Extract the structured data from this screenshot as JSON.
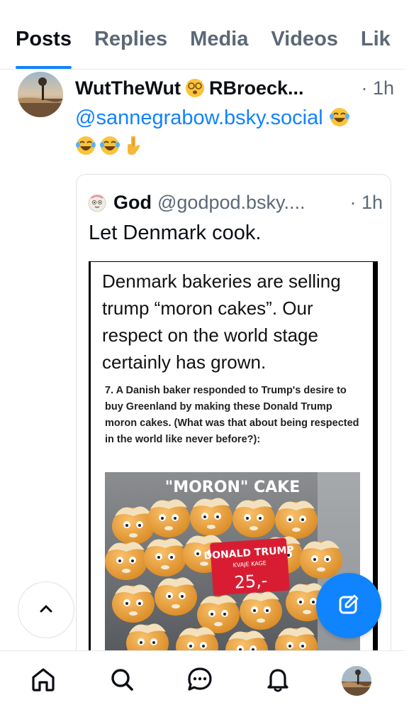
{
  "tabs": [
    {
      "label": "Posts"
    },
    {
      "label": "Replies"
    },
    {
      "label": "Media"
    },
    {
      "label": "Videos"
    },
    {
      "label": "Lik"
    }
  ],
  "post": {
    "author_name_part1": "WutTheWut",
    "author_name_part2": "RBroeck...",
    "time": "· 1h",
    "mention": "@sannegrabow.bsky.social",
    "emojis_line1": [
      "laughing-tears-emoji"
    ],
    "emojis_line2": [
      "laughing-tears-emoji",
      "laughing-tears-emoji",
      "pointing-down-emoji"
    ]
  },
  "quote": {
    "name": "God",
    "handle": "@godpod.bsky....",
    "time": "· 1h",
    "text": "Let Denmark cook.",
    "image": {
      "caption": "Denmark bakeries are selling trump “moron cakes”. Our respect on the world stage certainly has grown.",
      "subtext": "7. A Danish baker responded to Trump's desire to buy Greenland by making these Donald Trump moron cakes. (What was that about being respected in the world like never before?):",
      "photo_title": "\"MORON\" CAKE",
      "sign_title": "DONALD TRUMP",
      "sign_sub": "KVAJE KAGE",
      "sign_price": "25,-"
    }
  },
  "buttons": {
    "scroll_top_icon": "chevron-up-icon",
    "compose_icon": "compose-icon"
  },
  "nav": [
    {
      "name": "home-icon"
    },
    {
      "name": "search-icon"
    },
    {
      "name": "chat-icon"
    },
    {
      "name": "bell-icon"
    },
    {
      "name": "profile-avatar"
    }
  ],
  "colors": {
    "accent": "#1083fe",
    "muted": "#5b6877",
    "text": "#0b0f14"
  }
}
